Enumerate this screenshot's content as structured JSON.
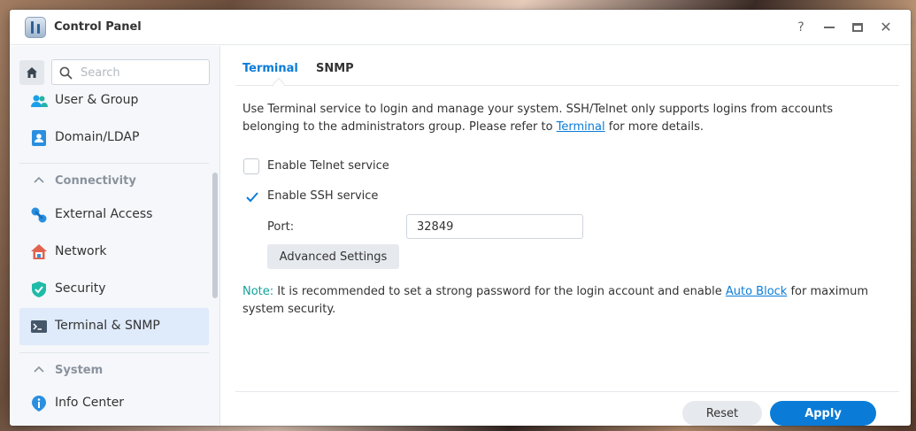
{
  "window": {
    "title": "Control Panel",
    "help_glyph": "?",
    "close_glyph": "✕"
  },
  "sidebar": {
    "search_placeholder": "Search",
    "items": [
      {
        "label": "User & Group",
        "icon": "user-group-icon"
      },
      {
        "label": "Domain/LDAP",
        "icon": "domain-ldap-icon"
      },
      {
        "section": "Connectivity"
      },
      {
        "label": "External Access",
        "icon": "external-access-icon"
      },
      {
        "label": "Network",
        "icon": "network-icon"
      },
      {
        "label": "Security",
        "icon": "security-shield-icon"
      },
      {
        "label": "Terminal & SNMP",
        "icon": "terminal-icon",
        "active": true
      },
      {
        "section": "System"
      },
      {
        "label": "Info Center",
        "icon": "info-icon"
      }
    ]
  },
  "tabs": [
    {
      "label": "Terminal",
      "active": true
    },
    {
      "label": "SNMP",
      "active": false
    }
  ],
  "content": {
    "description_pre": "Use Terminal service to login and manage your system. SSH/Telnet only supports logins from accounts belonging to the administrators group. Please refer to ",
    "description_link": "Terminal",
    "description_post": " for more details.",
    "telnet_label": "Enable Telnet service",
    "telnet_checked": false,
    "ssh_label": "Enable SSH service",
    "ssh_checked": true,
    "port_label": "Port:",
    "port_value": "32849",
    "advanced_label": "Advanced Settings",
    "note_tag": "Note:",
    "note_pre": " It is recommended to set a strong password for the login account and enable ",
    "note_link": "Auto Block",
    "note_post": " for maximum system security."
  },
  "footer": {
    "reset_label": "Reset",
    "apply_label": "Apply"
  },
  "colors": {
    "accent": "#0a7cd8",
    "note": "#11a39a",
    "active_nav_bg": "#dfeafa"
  }
}
